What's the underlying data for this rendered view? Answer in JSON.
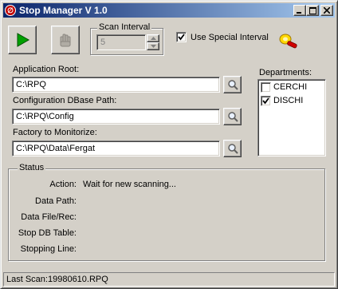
{
  "window": {
    "title": "Stop Manager V 1.0",
    "title_buttons": {
      "minimize": "_",
      "maximize": "□",
      "close": "×"
    }
  },
  "toolbar": {
    "start_icon": "play-icon",
    "stop_icon": "stop-hand-icon",
    "scan_interval_label": "Scan Interval",
    "scan_interval_value": "5",
    "use_special_interval_label": "Use Special Interval",
    "use_special_interval_checked": true,
    "special_icon": "key-tool-icon"
  },
  "paths": {
    "application_root_label": "Application Root:",
    "application_root_value": "C:\\RPQ",
    "config_path_label": "Configuration DBase Path:",
    "config_path_value": "C:\\RPQ\\Config",
    "factory_label": "Factory to Monitorize:",
    "factory_value": "C:\\RPQ\\Data\\Fergat"
  },
  "departments": {
    "label": "Departments:",
    "items": [
      {
        "label": "CERCHI",
        "checked": false
      },
      {
        "label": "DISCHI",
        "checked": true
      }
    ]
  },
  "status": {
    "group_label": "Status",
    "action_label": "Action:",
    "action_value": "Wait for new scanning...",
    "data_path_label": "Data Path:",
    "data_path_value": "",
    "data_file_label": "Data File/Rec:",
    "data_file_value": "",
    "stop_db_label": "Stop DB Table:",
    "stop_db_value": "",
    "stopping_line_label": "Stopping Line:",
    "stopping_line_value": ""
  },
  "statusbar": {
    "text": "Last Scan:19980610.RPQ"
  },
  "colors": {
    "title_start": "#0a246a",
    "title_end": "#a6caf0",
    "face": "#d4d0c8",
    "play_green": "#00a000"
  }
}
